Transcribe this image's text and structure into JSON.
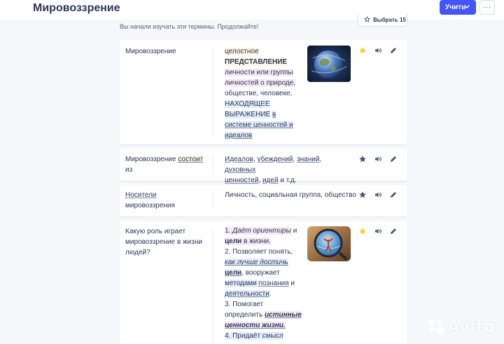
{
  "header": {
    "title": "Мировоззрение",
    "learn_label": "Учить",
    "more_label": "···"
  },
  "progress_text": "Вы начали изучать эти термины. Продолжайте!",
  "select_label": "Выбрать 15",
  "cards": [
    {
      "term": "Мировоззрение",
      "def_parts": [
        "целостное",
        "ПРЕДСТАВЛЕНИЕ",
        "личности или группы",
        "личностей о природе,",
        "обществе, человеке,",
        "НАХОДЯЩЕЕ",
        "ВЫРАЖЕНИЕ",
        "в",
        "системе ценностей и",
        "идеалов"
      ],
      "starred": true,
      "image": "earth-photo"
    },
    {
      "term_a": "Мировоззрение",
      "term_b": "состоит",
      "term_c": "из",
      "def_parts": [
        "Идеалов",
        ", ",
        "убеждений",
        ", ",
        "знаний",
        ", ",
        "духовных",
        "ценностей",
        ", ",
        "идей",
        " и т.д."
      ],
      "starred": false
    },
    {
      "term_a": "Носители",
      "term_b": "мировоззрения",
      "def": "Личность, социальная группа, общество",
      "starred": false
    },
    {
      "term_lines": [
        "Какую роль играет",
        "мировоззрение в жизни",
        "людей?"
      ],
      "def_parts": [
        "1. ",
        "Даёт ориентиры",
        " и",
        "цели",
        " в жизни.",
        "2. Позволяет понять,",
        "как лучше достичь",
        "цели",
        ", вооружает",
        "методами ",
        "познания",
        " и",
        "деятельности",
        ".",
        "3. Помогает",
        "определить ",
        "истинные",
        "ценности жизни.",
        "4. Придаёт ",
        "смысл"
      ],
      "starred": true,
      "image": "globe-person-photo"
    }
  ],
  "watermark": "Avito",
  "colors": {
    "accent": "#4255ff",
    "star_active": "#ffcd1f",
    "star_inactive": "#4a5578",
    "text": "#2e3856"
  }
}
